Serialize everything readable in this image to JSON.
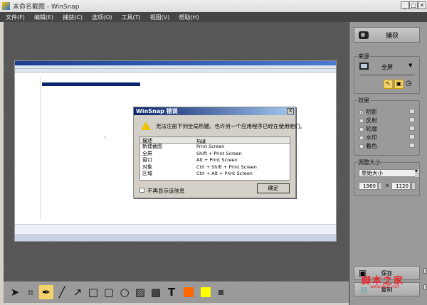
{
  "window": {
    "title": "未命名截图 - WinSnap",
    "controls": [
      "_",
      "□",
      "✕"
    ]
  },
  "menu": [
    "文件(F)",
    "编辑(E)",
    "捕获(C)",
    "选项(O)",
    "工具(T)",
    "视图(V)",
    "帮助(H)"
  ],
  "dialog": {
    "title": "WinSnap 错误",
    "close": "✕",
    "message": "无法注册下列全局热键。也许另一个应用程序已经在使用他们。",
    "columns": [
      "描述",
      "热键"
    ],
    "rows": [
      [
        "新建截图",
        "Print Screen"
      ],
      [
        "全屏",
        "Shift + Print Screen"
      ],
      [
        "窗口",
        "Alt + Print Screen"
      ],
      [
        "对象",
        "Ctrl + Shift + Print Screen"
      ],
      [
        "区域",
        "Ctrl + Alt + Print Screen"
      ]
    ],
    "checkbox_label": "不再显示该信息",
    "ok": "确定"
  },
  "panel": {
    "capture": "捕获",
    "source": {
      "label": "来源",
      "mode": "全屏"
    },
    "effects": {
      "label": "效果",
      "items": [
        {
          "name": "阴影",
          "checked": true
        },
        {
          "name": "反射",
          "checked": false
        },
        {
          "name": "轮廓",
          "checked": false
        },
        {
          "name": "水印",
          "checked": false
        },
        {
          "name": "着色",
          "checked": false
        }
      ]
    },
    "resize": {
      "label": "调整大小",
      "mode": "原始大小",
      "width": "1960",
      "x": "x",
      "height": "1120"
    },
    "save": "保存",
    "copy": "复制"
  },
  "watermark": {
    "text": "脚本之家",
    "url": "www.jb51.net"
  },
  "colors": {
    "primary": "#ff6600",
    "secondary": "#ffff00",
    "accent": "#f5d36b"
  }
}
